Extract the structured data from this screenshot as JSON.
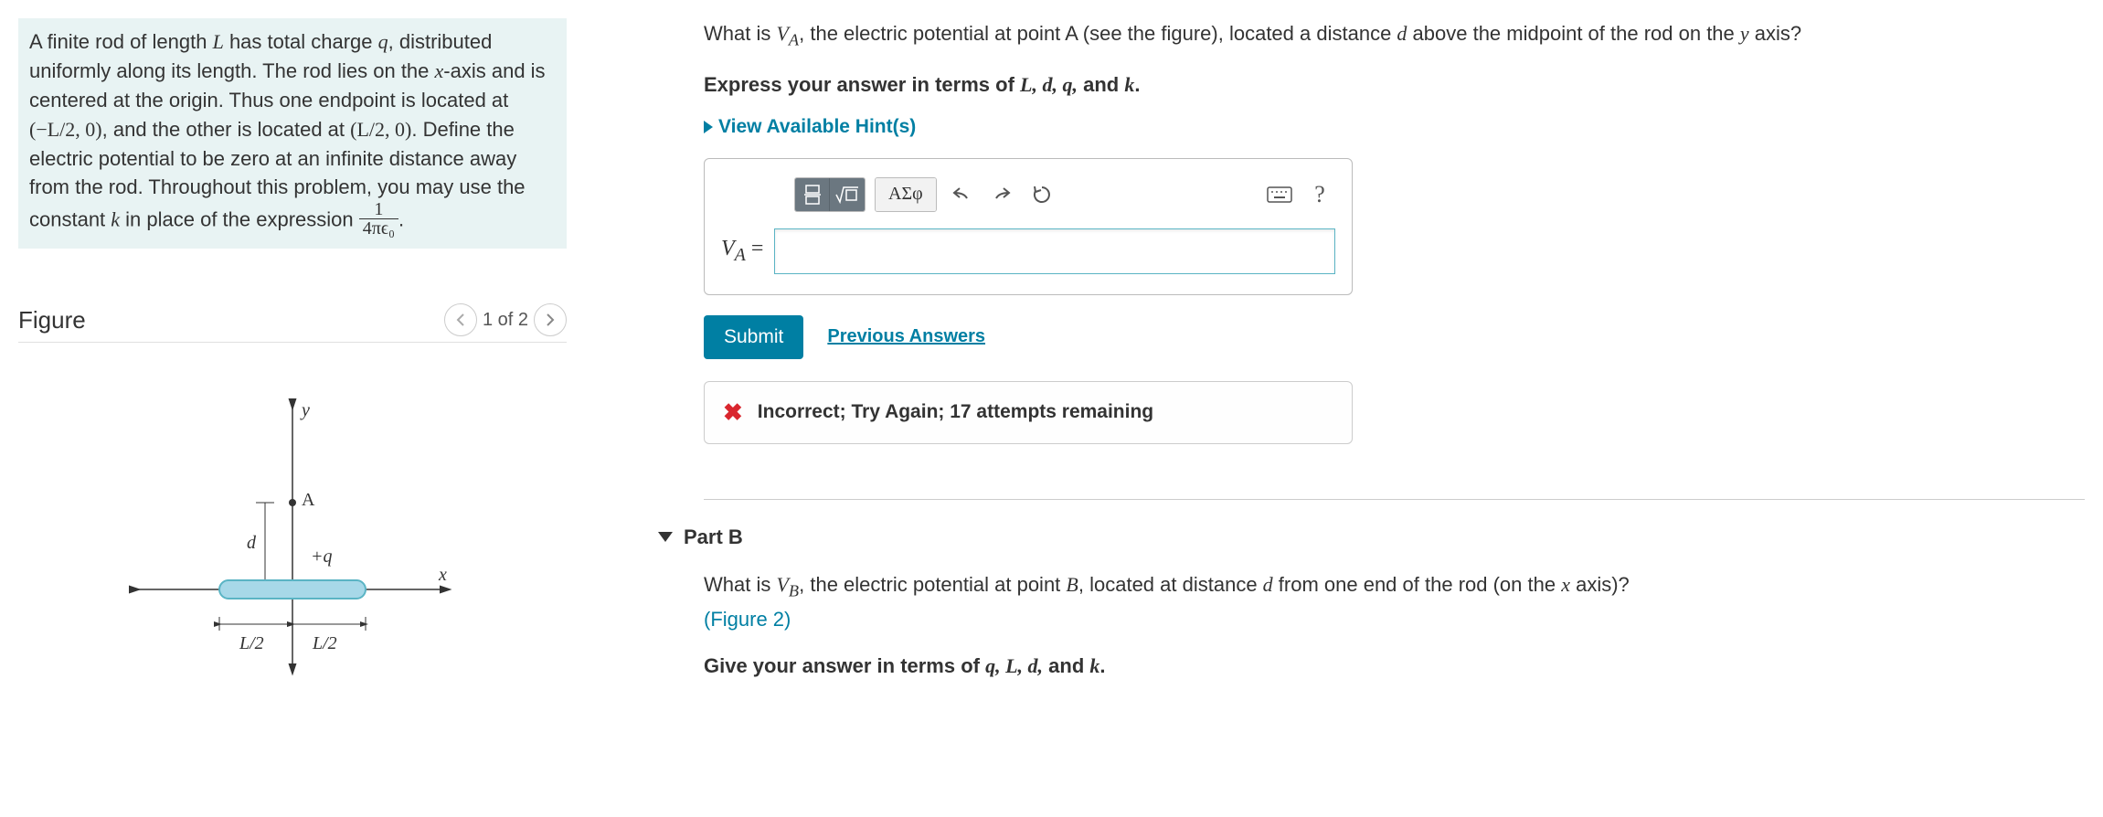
{
  "intro": {
    "line1a": "A finite rod of length ",
    "L": "L",
    "line1b": " has total charge ",
    "q": "q",
    "line1c": ", distributed uniformly along its length. The rod lies on the ",
    "xaxis": "x",
    "line1d": "-axis and is centered at the origin. Thus one endpoint is located at ",
    "pt1": "(−L/2, 0)",
    "line1e": ", and the other is located at ",
    "pt2": "(L/2, 0)",
    "line1f": ". Define the electric potential to be zero at an infinite distance away from the rod. Throughout this problem, you may use the constant ",
    "k": "k",
    "line1g": " in place of the expression ",
    "frac_num": "1",
    "frac_den": "4πϵ₀",
    "period": "."
  },
  "figure": {
    "title": "Figure",
    "counter": "1 of 2"
  },
  "partA": {
    "q1a": "What is ",
    "VA": "V",
    "VAsub": "A",
    "q1b": ", the electric potential at point A (see the figure), located a distance ",
    "d": "d",
    "q1c": " above the midpoint of the rod on the ",
    "yaxis": "y",
    "q1d": " axis?",
    "express": "Express your answer in terms of ",
    "exvars": "L, d, q,",
    "and": " and ",
    "kvar": "k",
    "exend": ".",
    "hints": "View Available Hint(s)",
    "greek": "ΑΣφ",
    "labelVA": "V",
    "labelVAsub": "A",
    "equals": " =",
    "submit": "Submit",
    "prev": "Previous Answers",
    "feedback": "Incorrect; Try Again; 17 attempts remaining"
  },
  "partB": {
    "title": "Part B",
    "q1a": "What is ",
    "VB": "V",
    "VBsub": "B",
    "q1b": ", the electric potential at point ",
    "Bpt": "B",
    "q1c": ", located at distance ",
    "d": "d",
    "q1d": " from one end of the rod (on the ",
    "xaxis": "x",
    "q1e": " axis)?",
    "figlink": "(Figure 2)",
    "give": "Give your answer in terms of ",
    "vars": "q, L, d,",
    "and": " and ",
    "kvar": "k",
    "end": "."
  }
}
